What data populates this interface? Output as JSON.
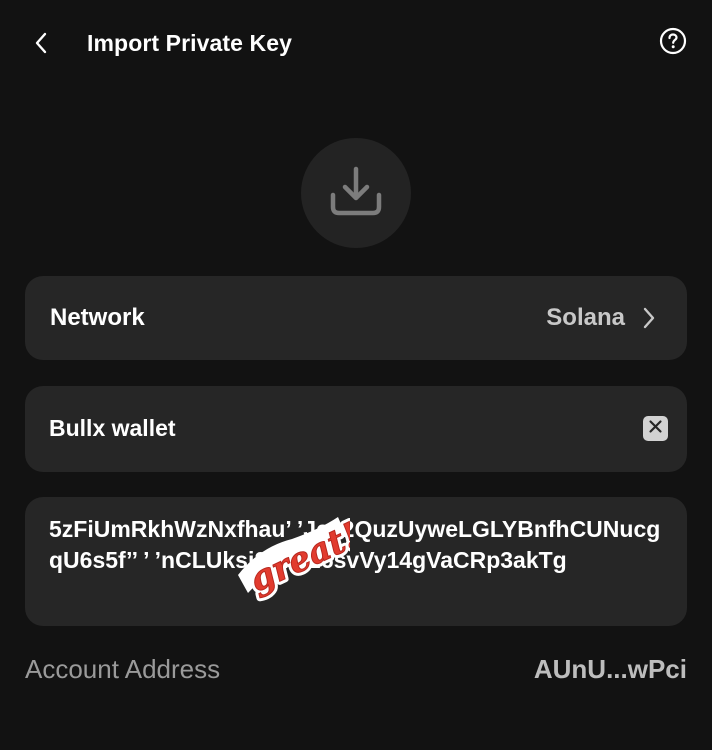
{
  "header": {
    "title": "Import Private Key",
    "back_icon": "chevron-left-icon",
    "help_icon": "help-circle-icon"
  },
  "hero": {
    "icon": "download-icon"
  },
  "network": {
    "label": "Network",
    "value": "Solana",
    "chevron_icon": "chevron-right-icon"
  },
  "wallet_name": {
    "value": "Bullx wallet",
    "clear_icon": "close-icon"
  },
  "private_key": {
    "value": "5zFiUmRkhWzNxfhau’ ’Je62QuzUyweLGLYBnfhCUNucgqU6s5f’’ ’ ’nCLUksi2XHr26svVy14gVaCRp3akTg"
  },
  "sticker": {
    "text": "great!",
    "color": "#e23b2e"
  },
  "account": {
    "label": "Account Address",
    "value": "AUnU...wPci"
  },
  "colors": {
    "background": "#121212",
    "card": "#262626",
    "text": "#ffffff",
    "muted": "#9a9a9a"
  }
}
